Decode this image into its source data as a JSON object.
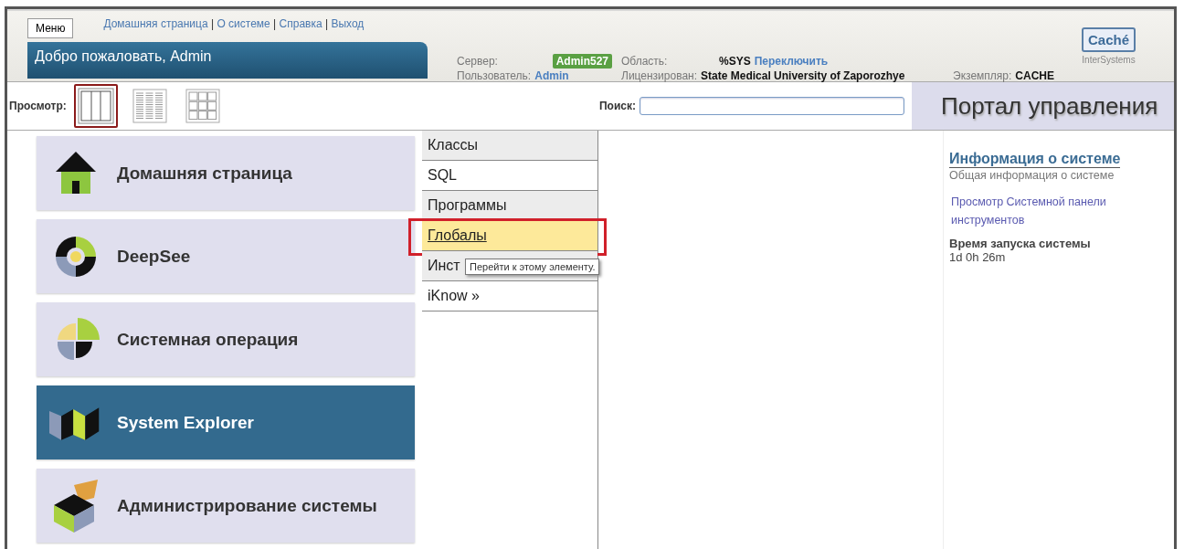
{
  "header": {
    "menu_button": "Меню",
    "links": [
      "Домашняя страница",
      "О системе",
      "Справка",
      "Выход"
    ],
    "link_separator": "|",
    "welcome": "Добро пожаловать, Admin",
    "info": {
      "server_label": "Сервер:",
      "server": "Admin527",
      "namespace_label": "Область:",
      "namespace": "%SYS",
      "switch_link": "Переключить",
      "user_label": "Пользователь:",
      "user": "Admin",
      "licensed_label": "Лицензирован:",
      "licensed": "State Medical University of Zaporozhye",
      "instance_label": "Экземпляр:",
      "instance": "CACHE"
    },
    "logo": {
      "product": "Caché",
      "company": "InterSystems"
    }
  },
  "toolbar": {
    "view_label": "Просмотр:",
    "views": [
      {
        "kind": "columns",
        "selected": true
      },
      {
        "kind": "list",
        "selected": false
      },
      {
        "kind": "grid",
        "selected": false
      }
    ],
    "search_label": "Поиск:",
    "portal_title": "Портал управления"
  },
  "tiles": [
    {
      "label": "Домашняя страница",
      "selected": false
    },
    {
      "label": "DeepSee",
      "selected": false
    },
    {
      "label": "Системная операция",
      "selected": false
    },
    {
      "label": "System Explorer",
      "selected": true
    },
    {
      "label": "Администрирование системы",
      "selected": false
    }
  ],
  "menu": [
    {
      "label": "Классы",
      "hovered": false,
      "highlighted": false
    },
    {
      "label": "SQL",
      "hovered": false,
      "highlighted": false
    },
    {
      "label": "Программы",
      "hovered": false,
      "highlighted": false
    },
    {
      "label": "Глобалы",
      "hovered": true,
      "highlighted": true
    },
    {
      "label": "Инст",
      "hovered": false,
      "highlighted": false
    },
    {
      "label": "iKnow »",
      "hovered": false,
      "highlighted": false
    }
  ],
  "tooltip": "Перейти к этому элементу.",
  "info_panel": {
    "title": "Информация о системе",
    "subtitle": "Общая информация о системе",
    "link": "Просмотр Системной панели инструментов",
    "uptime_label": "Время запуска системы",
    "uptime": "1d 0h 26m"
  }
}
